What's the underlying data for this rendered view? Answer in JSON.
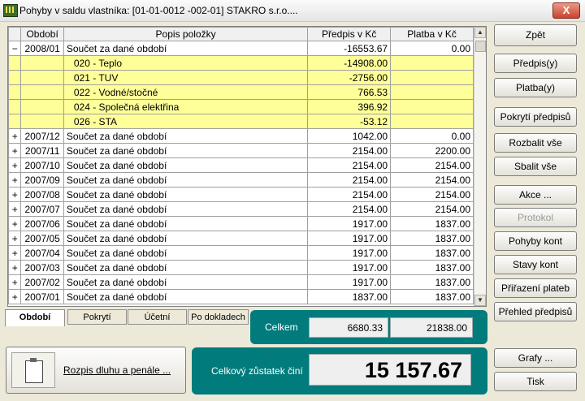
{
  "window": {
    "title": "Pohyby v saldu vlastníka: [01-01-0012 -002-01]  STAKRO s.r.o....",
    "close_label": "X"
  },
  "grid": {
    "headers": [
      "",
      "Období",
      "Popis položky",
      "Předpis v Kč",
      "Platba v Kč"
    ],
    "rows": [
      {
        "expander": "−",
        "period": "2008/01",
        "desc": "Součet za dané období",
        "predpis": "-16553.67",
        "platba": "0.00",
        "sub": false,
        "current": true
      },
      {
        "expander": "",
        "period": "",
        "desc": "020 - Teplo",
        "predpis": "-14908.00",
        "platba": "",
        "sub": true,
        "current": false
      },
      {
        "expander": "",
        "period": "",
        "desc": "021 - TUV",
        "predpis": "-2756.00",
        "platba": "",
        "sub": true,
        "current": false
      },
      {
        "expander": "",
        "period": "",
        "desc": "022 - Vodné/stočné",
        "predpis": "766.53",
        "platba": "",
        "sub": true,
        "current": false
      },
      {
        "expander": "",
        "period": "",
        "desc": "024 - Společná elektřina",
        "predpis": "396.92",
        "platba": "",
        "sub": true,
        "current": false
      },
      {
        "expander": "",
        "period": "",
        "desc": "026 - STA",
        "predpis": "-53.12",
        "platba": "",
        "sub": true,
        "current": false
      },
      {
        "expander": "+",
        "period": "2007/12",
        "desc": "Součet za dané období",
        "predpis": "1042.00",
        "platba": "0.00",
        "sub": false,
        "current": false
      },
      {
        "expander": "+",
        "period": "2007/11",
        "desc": "Součet za dané období",
        "predpis": "2154.00",
        "platba": "2200.00",
        "sub": false,
        "current": false
      },
      {
        "expander": "+",
        "period": "2007/10",
        "desc": "Součet za dané období",
        "predpis": "2154.00",
        "platba": "2154.00",
        "sub": false,
        "current": false
      },
      {
        "expander": "+",
        "period": "2007/09",
        "desc": "Součet za dané období",
        "predpis": "2154.00",
        "platba": "2154.00",
        "sub": false,
        "current": false
      },
      {
        "expander": "+",
        "period": "2007/08",
        "desc": "Součet za dané období",
        "predpis": "2154.00",
        "platba": "2154.00",
        "sub": false,
        "current": false
      },
      {
        "expander": "+",
        "period": "2007/07",
        "desc": "Součet za dané období",
        "predpis": "2154.00",
        "platba": "2154.00",
        "sub": false,
        "current": false
      },
      {
        "expander": "+",
        "period": "2007/06",
        "desc": "Součet za dané období",
        "predpis": "1917.00",
        "platba": "1837.00",
        "sub": false,
        "current": false
      },
      {
        "expander": "+",
        "period": "2007/05",
        "desc": "Součet za dané období",
        "predpis": "1917.00",
        "platba": "1837.00",
        "sub": false,
        "current": false
      },
      {
        "expander": "+",
        "period": "2007/04",
        "desc": "Součet za dané období",
        "predpis": "1917.00",
        "platba": "1837.00",
        "sub": false,
        "current": false
      },
      {
        "expander": "+",
        "period": "2007/03",
        "desc": "Součet za dané období",
        "predpis": "1917.00",
        "platba": "1837.00",
        "sub": false,
        "current": false
      },
      {
        "expander": "+",
        "period": "2007/02",
        "desc": "Součet za dané období",
        "predpis": "1917.00",
        "platba": "1837.00",
        "sub": false,
        "current": false
      },
      {
        "expander": "+",
        "period": "2007/01",
        "desc": "Součet za dané období",
        "predpis": "1837.00",
        "platba": "1837.00",
        "sub": false,
        "current": false
      }
    ]
  },
  "tabs": [
    "Období",
    "Pokrytí",
    "Účetní",
    "Po dokladech"
  ],
  "totals": {
    "label": "Celkem",
    "predpis": "6680.33",
    "platba": "21838.00",
    "balance_label": "Celkový zůstatek činí",
    "balance_value": "15 157.67"
  },
  "bottom": {
    "rozpis_label": "Rozpis dluhu a penále ..."
  },
  "buttons": {
    "zpet": "Zpět",
    "predpis": "Předpis(y)",
    "platba": "Platba(y)",
    "pokryti": "Pokrytí předpisů",
    "rozbalit": "Rozbalit vše",
    "sbalit": "Sbalit vše",
    "akce": "Akce ...",
    "protokol": "Protokol",
    "pohyby_kont": "Pohyby kont",
    "stavy_kont": "Stavy kont",
    "prirazeni": "Přiřazení plateb",
    "prehled": "Přehled předpisů",
    "grafy": "Grafy ...",
    "tisk": "Tisk"
  }
}
